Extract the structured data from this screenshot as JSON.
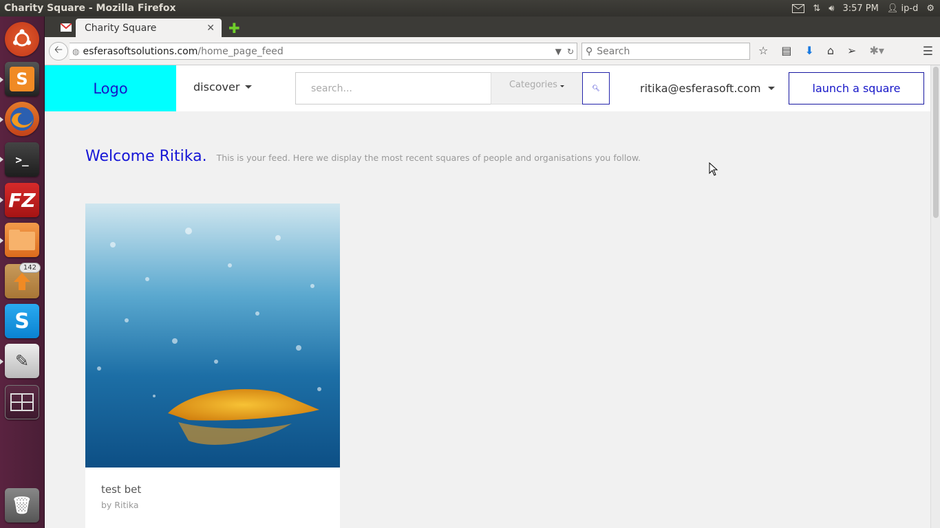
{
  "system": {
    "window_title": "Charity Square - Mozilla Firefox",
    "time": "3:57 PM",
    "user": "ip-d"
  },
  "launcher": {
    "items": [
      {
        "name": "ubuntu-dash-icon"
      },
      {
        "name": "sublime-text-icon",
        "glyph": "S"
      },
      {
        "name": "firefox-icon"
      },
      {
        "name": "terminal-icon",
        "glyph": ">_"
      },
      {
        "name": "filezilla-icon",
        "glyph": "FZ"
      },
      {
        "name": "files-icon"
      },
      {
        "name": "software-updater-icon",
        "badge": "142"
      },
      {
        "name": "skype-icon",
        "glyph": "S"
      },
      {
        "name": "text-editor-icon"
      },
      {
        "name": "workspace-switcher-icon"
      },
      {
        "name": "trash-icon"
      }
    ]
  },
  "browser": {
    "tab_title": "Charity Square",
    "url_host": "esferasoftsolutions.com",
    "url_path": "/home_page_feed",
    "search_placeholder": "Search"
  },
  "site": {
    "logo": "Logo",
    "discover": "discover",
    "search_placeholder": "search...",
    "categories": "Categories",
    "user_email": "ritika@esferasoft.com",
    "launch_button": "launch a square"
  },
  "welcome": {
    "heading": "Welcome Ritika.",
    "subtitle": "This is your feed. Here we display the most recent squares of people and organisations you follow."
  },
  "feed": [
    {
      "title": "test bet",
      "author": "by Ritika"
    }
  ],
  "colors": {
    "logo_bg": "#00ffff",
    "brand_blue": "#1616c8"
  }
}
